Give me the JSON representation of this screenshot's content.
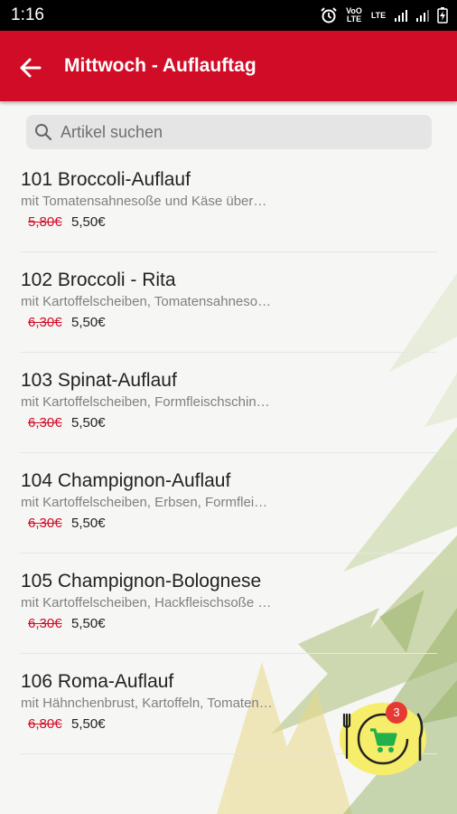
{
  "status_bar": {
    "time": "1:16",
    "volte_label": "VoO LTE",
    "lte_label": "LTE"
  },
  "header": {
    "title": "Mittwoch - Auflauftag"
  },
  "search": {
    "placeholder": "Artikel suchen",
    "value": ""
  },
  "items": [
    {
      "name": "101 Broccoli-Auflauf",
      "description": "mit Tomatensahnesoße und Käse überbacken",
      "old_price": "5,80€",
      "price": "5,50€"
    },
    {
      "name": "102 Broccoli - Rita",
      "description": "mit Kartoffelscheiben, Tomatensahnesoße und Käse",
      "old_price": "6,30€",
      "price": "5,50€"
    },
    {
      "name": "103 Spinat-Auflauf",
      "description": "mit Kartoffelscheiben, Formfleischschinken und Käse",
      "old_price": "6,30€",
      "price": "5,50€"
    },
    {
      "name": "104 Champignon-Auflauf",
      "description": "mit Kartoffelscheiben, Erbsen, Formfleischschinken",
      "old_price": "6,30€",
      "price": "5,50€"
    },
    {
      "name": "105 Champignon-Bolognese",
      "description": "mit Kartoffelscheiben, Hackfleischsoße und Käse",
      "old_price": "6,30€",
      "price": "5,50€"
    },
    {
      "name": "106 Roma-Auflauf",
      "description": "mit Hähnchenbrust, Kartoffeln, Tomatensoße und Käse",
      "old_price": "6,80€",
      "price": "5,50€"
    }
  ],
  "cart": {
    "count": "3",
    "icon": "cart-icon"
  },
  "colors": {
    "primary": "#d10c27",
    "strike": "#d10c27",
    "cart_bg": "#f6ee6a",
    "cart_icon": "#22b04a",
    "badge": "#e53935"
  }
}
